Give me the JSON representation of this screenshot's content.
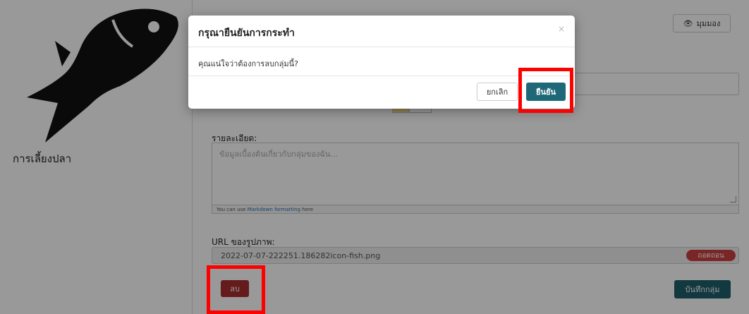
{
  "sidebar": {
    "group_name": "การเลี้ยงปลา"
  },
  "header": {
    "view_label": "มุมมอง",
    "view_icon": "eye-icon"
  },
  "form": {
    "description_label": "รายละเอียด:",
    "description_placeholder": "ข้อมูลเบื้องต้นเกี่ยวกับกลุ่มของฉัน...",
    "markdown_hint_prefix": "You can use ",
    "markdown_hint_link": "Markdown formatting",
    "markdown_hint_suffix": " here",
    "image_url_label": "URL ของรูปภาพ:",
    "image_url_value": "2022-07-07-222251.186282icon-fish.png",
    "remove_label": "ถอดถอน",
    "delete_label": "ลบ",
    "save_label": "บันทึกกลุ่ม"
  },
  "modal": {
    "title": "กรุณายืนยันการกระทำ",
    "close_symbol": "×",
    "message": "คุณแน่ใจว่าต้องการลบกลุ่มนี้?",
    "cancel_label": "ยกเลิก",
    "confirm_label": "ยืนยัน"
  },
  "colors": {
    "confirm": "#1f6878",
    "delete": "#a82d2d",
    "highlight": "#ff0000"
  }
}
